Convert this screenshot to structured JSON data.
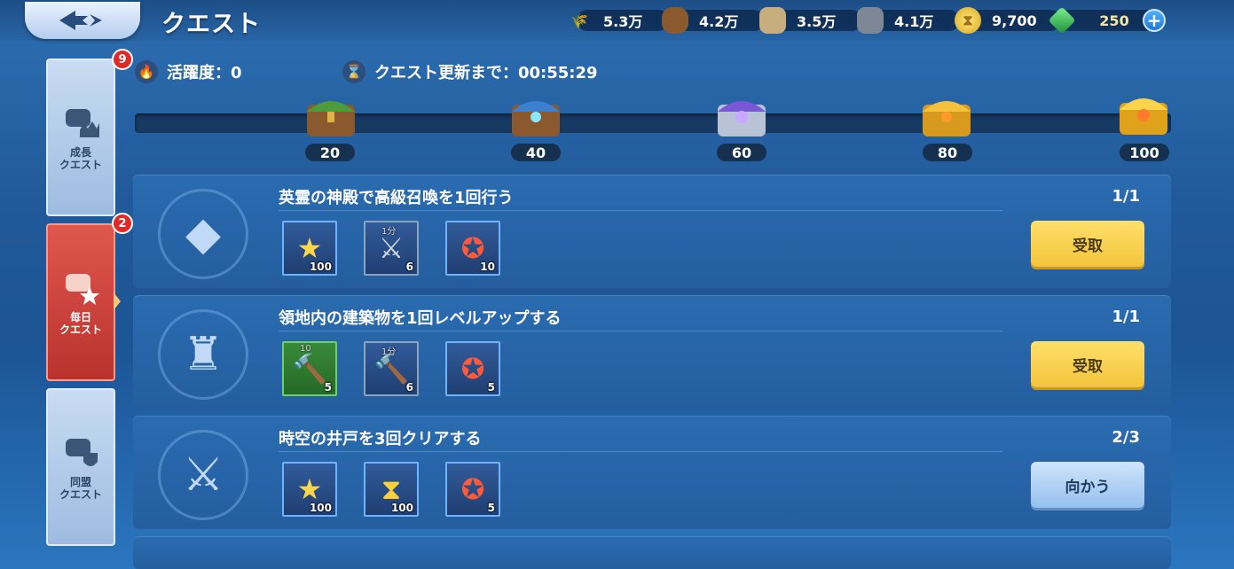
{
  "header": {
    "title": "クエスト",
    "resources": [
      {
        "icon": "wheat-icon",
        "value": "5.3万"
      },
      {
        "icon": "wood-log-icon",
        "value": "4.2万"
      },
      {
        "icon": "stone-icon",
        "value": "3.5万"
      },
      {
        "icon": "iron-ore-icon",
        "value": "4.1万"
      },
      {
        "icon": "gold-coin-icon",
        "value": "9,700"
      },
      {
        "icon": "gem-icon",
        "value": "250"
      }
    ]
  },
  "sidebar": {
    "tabs": [
      {
        "label": "成長\nクエスト",
        "badge": "9",
        "active": false
      },
      {
        "label": "毎日\nクエスト",
        "badge": "2",
        "active": true
      },
      {
        "label": "同盟\nクエスト",
        "badge": "",
        "active": false
      }
    ]
  },
  "activity": {
    "label": "活躍度：0"
  },
  "refresh": {
    "label": "クエスト更新まで：00:55:29"
  },
  "milestones": [
    {
      "value": "20",
      "chest": "green"
    },
    {
      "value": "40",
      "chest": "blue"
    },
    {
      "value": "60",
      "chest": "purple"
    },
    {
      "value": "80",
      "chest": "gold"
    },
    {
      "value": "100",
      "chest": "gold-large"
    }
  ],
  "quests": [
    {
      "title": "英霊の神殿で高級召喚を1回行う",
      "progress": "1/1",
      "button": "受取",
      "emblem": "crystal-crown-icon",
      "rewards": [
        {
          "icon": "shield-star-icon",
          "count": "100",
          "tag": ""
        },
        {
          "icon": "sword-speedup-icon",
          "count": "6",
          "tag": "1分"
        },
        {
          "icon": "star-medal-icon",
          "count": "10",
          "tag": ""
        }
      ]
    },
    {
      "title": "領地内の建築物を1回レベルアップする",
      "progress": "1/1",
      "button": "受取",
      "emblem": "castle-upgrade-icon",
      "rewards": [
        {
          "icon": "hammer-scroll-icon",
          "count": "5",
          "tag": "10"
        },
        {
          "icon": "hammer-speedup-icon",
          "count": "6",
          "tag": "1分"
        },
        {
          "icon": "star-medal-icon",
          "count": "5",
          "tag": ""
        }
      ]
    },
    {
      "title": "時空の井戸を3回クリアする",
      "progress": "2/3",
      "button": "向かう",
      "emblem": "banner-swords-icon",
      "rewards": [
        {
          "icon": "shield-star-icon",
          "count": "100",
          "tag": ""
        },
        {
          "icon": "hourglass-coin-icon",
          "count": "100",
          "tag": ""
        },
        {
          "icon": "star-medal-icon",
          "count": "5",
          "tag": ""
        }
      ]
    }
  ]
}
